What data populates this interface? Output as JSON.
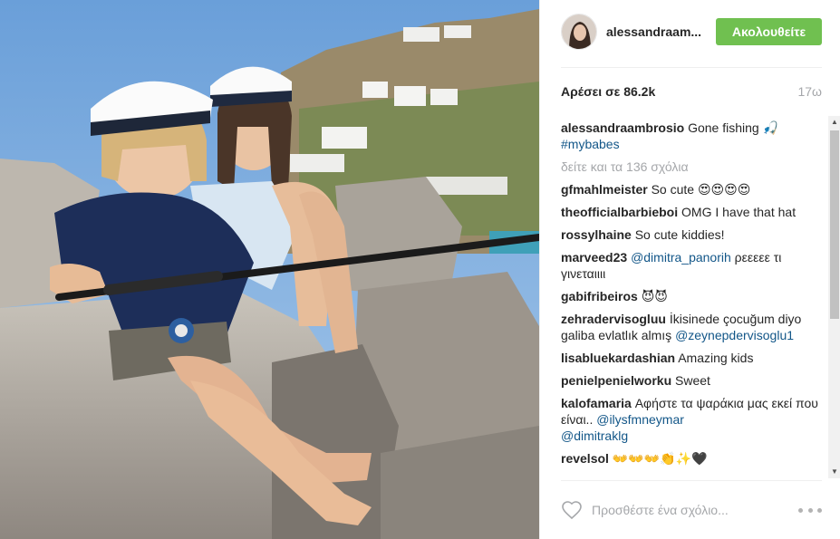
{
  "post": {
    "username": "alessandraam...",
    "follow_label": "Ακολουθείτε",
    "likes": "Αρέσει σε 86.2k",
    "time": "17ω",
    "caption_user": "alessandraambrosio",
    "caption_text": "Gone fishing 🎣",
    "caption_tag": "#mybabes",
    "view_all": "δείτε και τα 136 σχόλια"
  },
  "comments": [
    {
      "user": "gfmahlmeister",
      "text": "So cute 😍😍😍😍"
    },
    {
      "user": "theofficialbarbieboi",
      "text": "OMG I have that hat"
    },
    {
      "user": "rossylhaine",
      "text": "So cute kiddies!"
    },
    {
      "user": "marveed23",
      "mention": "@dimitra_panorih",
      "text": " ρεεεεε τι γινεταιιιι"
    },
    {
      "user": "gabifribeiros",
      "text": "😈😈"
    },
    {
      "user": "zehradervisogluu",
      "text": "İkisinede çocuğum diyo galiba evlatlık almış ",
      "mention2": "@zeynepdervisoglu1"
    },
    {
      "user": "lisabluekardashian",
      "text": "Amazing kids"
    },
    {
      "user": "penielpenielworku",
      "text": "Sweet"
    },
    {
      "user": "kalofamaria",
      "text": "Αφήστε τα ψαράκια μας εκεί που είναι.. ",
      "mention2": "@ilysfmneymar",
      "mention3": "@dimitraklg"
    },
    {
      "user": "revelsol",
      "text": "👐👐👐👏✨🖤"
    }
  ],
  "comment_input": {
    "placeholder": "Προσθέστε ένα σχόλιο..."
  },
  "icons": {
    "like": "heart-icon",
    "more": "more-options-icon"
  },
  "colors": {
    "follow": "#70c050",
    "link": "#125688",
    "muted": "#a5a7aa"
  }
}
